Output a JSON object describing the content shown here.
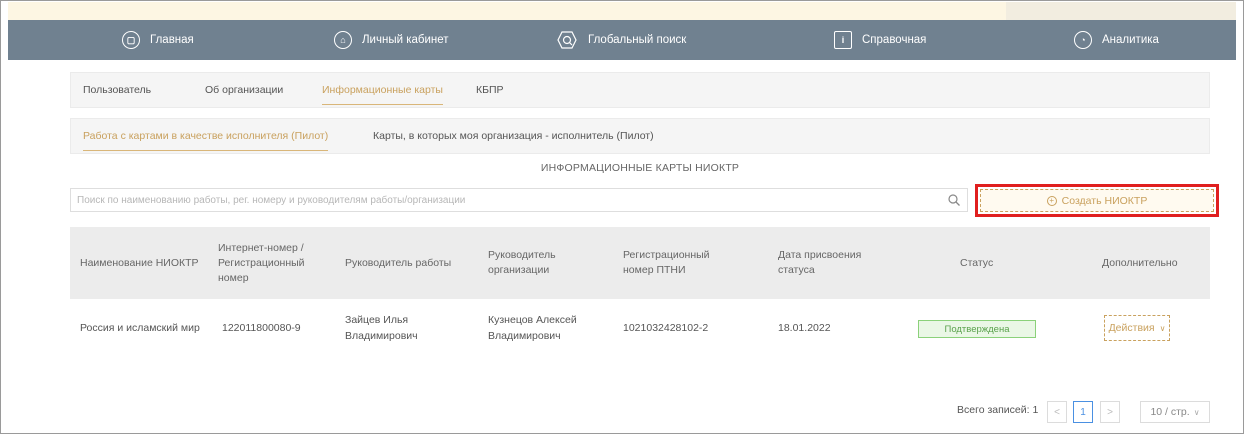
{
  "nav": {
    "items": [
      {
        "label": "Главная",
        "icon": "home-icon"
      },
      {
        "label": "Личный кабинет",
        "icon": "user-icon"
      },
      {
        "label": "Глобальный поиск",
        "icon": "global-search-icon"
      },
      {
        "label": "Справочная",
        "icon": "info-icon"
      },
      {
        "label": "Аналитика",
        "icon": "analytics-icon"
      }
    ]
  },
  "tabs_main": [
    {
      "label": "Пользователь",
      "active": false
    },
    {
      "label": "Об организации",
      "active": false
    },
    {
      "label": "Информационные карты",
      "active": true
    },
    {
      "label": "КБПР",
      "active": false
    }
  ],
  "tabs_sub": [
    {
      "label": "Работа с картами в качестве исполнителя (Пилот)",
      "active": true
    },
    {
      "label": "Карты, в которых моя организация - исполнитель (Пилот)",
      "active": false
    }
  ],
  "section_title": "ИНФОРМАЦИОННЫЕ КАРТЫ НИОКТР",
  "search": {
    "placeholder": "Поиск по наименованию работы, рег. номеру и руководителям работы/организации",
    "value": ""
  },
  "create_button": {
    "label": "Создать НИОКТР"
  },
  "table": {
    "headers": [
      "Наименование НИОКТР",
      "Интернет-номер / Регистрационный номер",
      "Руководитель работы",
      "Руководитель организации",
      "Регистрационный номер ПТНИ",
      "Дата присвоения статуса",
      "Статус",
      "Дополнительно"
    ],
    "rows": [
      {
        "name": "Россия и исламский мир",
        "number": "122011800080-9",
        "work_head": "Зайцев Илья Владимирович",
        "org_head": "Кузнецов Алексей Владимирович",
        "ptni": "1021032428102-2",
        "date": "18.01.2022",
        "status": "Подтверждена",
        "actions": "Действия"
      }
    ]
  },
  "pagination": {
    "total_label": "Всего записей: 1",
    "current_page": "1",
    "page_size": "10 / стр."
  },
  "colors": {
    "navbar": "#708190",
    "accent": "#c9a15e",
    "highlight": "#e01f1f",
    "status_green": "#5aa24c"
  }
}
